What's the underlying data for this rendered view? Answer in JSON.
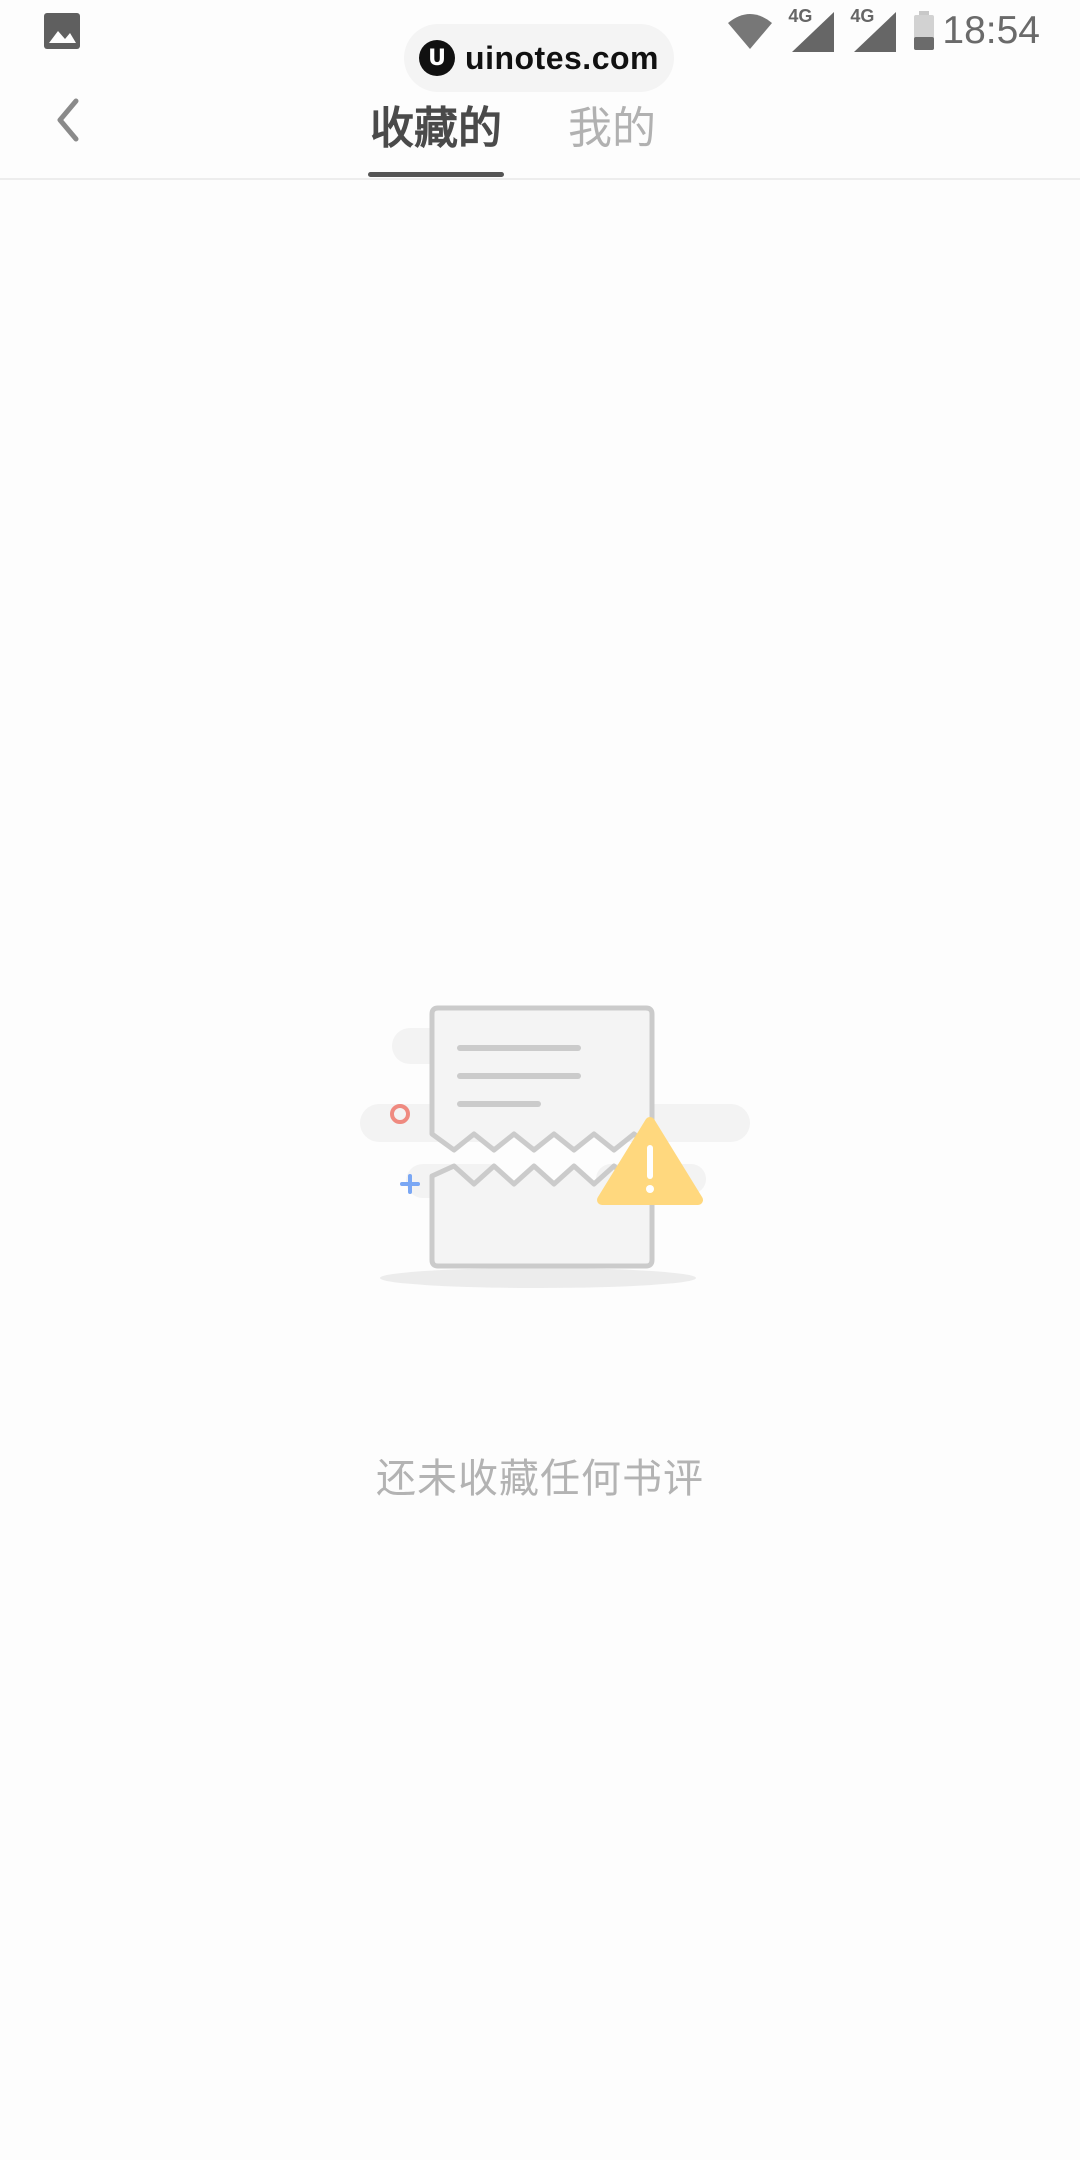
{
  "status_bar": {
    "time": "18:54",
    "network_1": "4G",
    "network_2": "4G",
    "icons": [
      "gallery-icon",
      "wifi-icon",
      "signal-icon",
      "signal-icon",
      "battery-icon"
    ]
  },
  "watermark": {
    "logo_letter": "U",
    "text": "uinotes.com"
  },
  "header": {
    "back_icon": "chevron-left-icon",
    "tabs": [
      {
        "label": "收藏的",
        "active": true
      },
      {
        "label": "我的",
        "active": false
      }
    ]
  },
  "empty_state": {
    "illustration": "broken-document-warning-icon",
    "message": "还未收藏任何书评"
  },
  "colors": {
    "background": "#fdfdfd",
    "active_tab": "#4a4a4a",
    "inactive_tab": "#b1b1b1",
    "indicator": "#555555",
    "warning": "#ffd87e",
    "empty_text": "#b3b3b3"
  }
}
